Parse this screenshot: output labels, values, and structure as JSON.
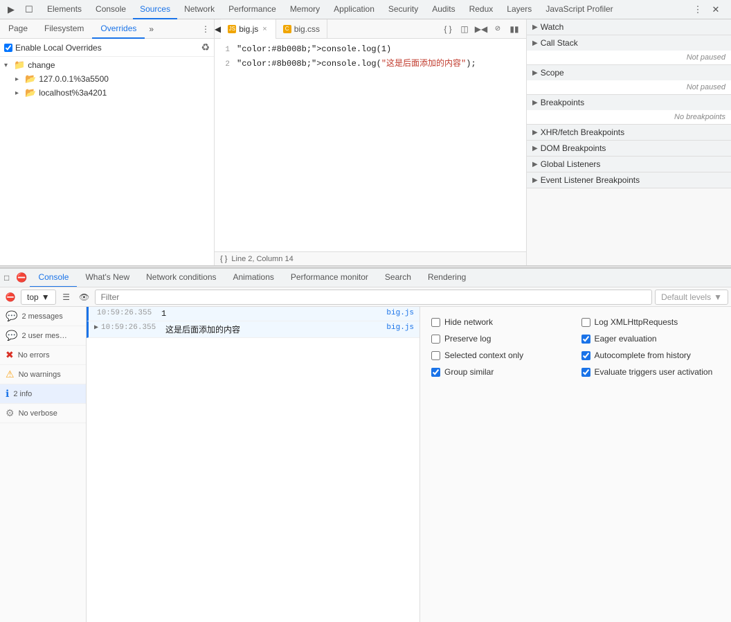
{
  "topTabs": {
    "items": [
      {
        "id": "elements",
        "label": "Elements",
        "active": false
      },
      {
        "id": "console",
        "label": "Console",
        "active": false
      },
      {
        "id": "sources",
        "label": "Sources",
        "active": true
      },
      {
        "id": "network",
        "label": "Network",
        "active": false
      },
      {
        "id": "performance",
        "label": "Performance",
        "active": false
      },
      {
        "id": "memory",
        "label": "Memory",
        "active": false
      },
      {
        "id": "application",
        "label": "Application",
        "active": false
      },
      {
        "id": "security",
        "label": "Security",
        "active": false
      },
      {
        "id": "audits",
        "label": "Audits",
        "active": false
      },
      {
        "id": "redux",
        "label": "Redux",
        "active": false
      },
      {
        "id": "layers",
        "label": "Layers",
        "active": false
      },
      {
        "id": "javascript-profiler",
        "label": "JavaScript Profiler",
        "active": false
      }
    ]
  },
  "leftPanel": {
    "subTabs": [
      {
        "label": "Page",
        "active": false
      },
      {
        "label": "Filesystem",
        "active": false
      },
      {
        "label": "Overrides",
        "active": true
      }
    ],
    "enableLocalOverrides": {
      "label": "Enable Local Overrides",
      "checked": true
    },
    "fileTree": [
      {
        "type": "folder",
        "name": "change",
        "depth": 0,
        "expanded": true
      },
      {
        "type": "folder",
        "name": "127.0.0.1%3a5500",
        "depth": 1,
        "expanded": false
      },
      {
        "type": "folder",
        "name": "localhost%3a4201",
        "depth": 1,
        "expanded": false
      }
    ]
  },
  "editor": {
    "tabs": [
      {
        "label": "big.js",
        "active": true,
        "closable": true
      },
      {
        "label": "big.css",
        "active": false,
        "closable": false
      }
    ],
    "lines": [
      {
        "num": 1,
        "code": "console.log(1)"
      },
      {
        "num": 2,
        "code": "console.log(\"这是后面添加的内容\");"
      }
    ],
    "statusBar": {
      "position": "Line 2, Column 14"
    }
  },
  "debugPanel": {
    "sections": [
      {
        "id": "watch",
        "label": "Watch",
        "collapsed": true,
        "content": null
      },
      {
        "id": "call-stack",
        "label": "Call Stack",
        "collapsed": true,
        "content": "Not paused"
      },
      {
        "id": "scope",
        "label": "Scope",
        "collapsed": true,
        "content": "Not paused"
      },
      {
        "id": "breakpoints",
        "label": "Breakpoints",
        "collapsed": true,
        "content": "No breakpoints"
      },
      {
        "id": "xhr-breakpoints",
        "label": "XHR/fetch Breakpoints",
        "collapsed": true,
        "content": null
      },
      {
        "id": "dom-breakpoints",
        "label": "DOM Breakpoints",
        "collapsed": true,
        "content": null
      },
      {
        "id": "global-listeners",
        "label": "Global Listeners",
        "collapsed": true,
        "content": null
      },
      {
        "id": "event-listener-breakpoints",
        "label": "Event Listener Breakpoints",
        "collapsed": true,
        "content": null
      }
    ]
  },
  "bottomPanel": {
    "tabs": [
      {
        "label": "Console",
        "active": true
      },
      {
        "label": "What's New",
        "active": false
      },
      {
        "label": "Network conditions",
        "active": false
      },
      {
        "label": "Animations",
        "active": false
      },
      {
        "label": "Performance monitor",
        "active": false
      },
      {
        "label": "Search",
        "active": false
      },
      {
        "label": "Rendering",
        "active": false
      }
    ],
    "toolbar": {
      "context": "top",
      "filterPlaceholder": "Filter",
      "levelsLabel": "Default levels"
    },
    "sidebar": {
      "items": [
        {
          "icon": "messages",
          "label": "2 messages",
          "count": "2",
          "type": "all",
          "selected": false
        },
        {
          "icon": "messages",
          "label": "2 user mes…",
          "count": "2",
          "type": "user",
          "selected": false
        },
        {
          "icon": "error",
          "label": "No errors",
          "type": "error",
          "selected": false
        },
        {
          "icon": "warning",
          "label": "No warnings",
          "type": "warning",
          "selected": false
        },
        {
          "icon": "info",
          "label": "2 info",
          "count": "2",
          "type": "info",
          "selected": true
        },
        {
          "icon": "verbose",
          "label": "No verbose",
          "type": "verbose",
          "selected": false
        }
      ]
    },
    "messages": [
      {
        "id": 1,
        "time": "10:59:26.355",
        "content": "1",
        "source": "big.js",
        "type": "info",
        "expandable": false
      },
      {
        "id": 2,
        "time": "10:59:26.355",
        "content": "这是后面添加的内容",
        "source": "big.js",
        "type": "info",
        "expandable": true
      }
    ],
    "settings": {
      "items": [
        {
          "id": "hide-network",
          "label": "Hide network",
          "checked": false
        },
        {
          "id": "log-xml",
          "label": "Log XMLHttpRequests",
          "checked": false
        },
        {
          "id": "preserve-log",
          "label": "Preserve log",
          "checked": false
        },
        {
          "id": "eager-evaluation",
          "label": "Eager evaluation",
          "checked": true
        },
        {
          "id": "selected-context",
          "label": "Selected context only",
          "checked": false
        },
        {
          "id": "autocomplete-history",
          "label": "Autocomplete from history",
          "checked": true
        },
        {
          "id": "group-similar",
          "label": "Group similar",
          "checked": true
        },
        {
          "id": "evaluate-triggers",
          "label": "Evaluate triggers user activation",
          "checked": true
        }
      ]
    }
  }
}
